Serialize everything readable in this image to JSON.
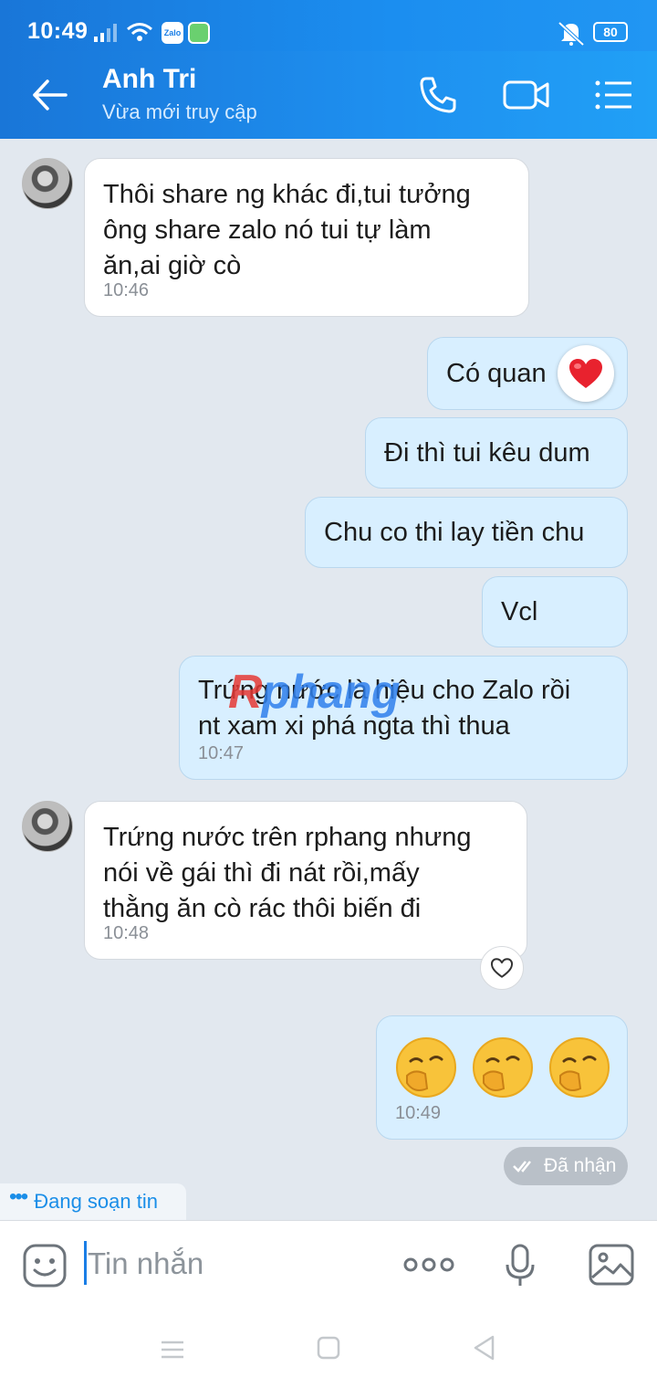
{
  "status_bar": {
    "time": "10:49",
    "battery": "80",
    "zalo_icon_label": "Zalo"
  },
  "header": {
    "contact_name": "Anh Tri",
    "presence": "Vừa mới truy cập"
  },
  "messages": [
    {
      "direction": "in",
      "text": "Thôi share ng khác đi,tui tưởng\nông share zalo nó tui tự làm\năn,ai giờ cò",
      "time": "10:46"
    },
    {
      "direction": "out",
      "text": "Có quan",
      "reaction": "heart"
    },
    {
      "direction": "out",
      "text": "Đi thì tui kêu dum"
    },
    {
      "direction": "out",
      "text": "Chu co thi lay tiền chu"
    },
    {
      "direction": "out",
      "text": "Vcl"
    },
    {
      "direction": "out",
      "text": "Trứng nước là hiệu cho Zalo rồi\nnt xam xi phá ngta thì thua",
      "time": "10:47"
    },
    {
      "direction": "in",
      "text": "Trứng nước trên rphang nhưng\nnói về gái thì đi nát rồi,mấy\nthằng ăn cò rác thôi biến đi",
      "time": "10:48"
    },
    {
      "direction": "out",
      "emojis": [
        "shy-yawn-face",
        "shy-yawn-face",
        "shy-yawn-face"
      ],
      "time": "10:49"
    }
  ],
  "watermark": {
    "part1": "R",
    "part2": "phang"
  },
  "delivery_status": "Đã nhận",
  "typing_indicator": "Đang soạn tin",
  "composer": {
    "placeholder": "Tin nhắn"
  },
  "icons": {
    "back": "arrow-left-icon",
    "call": "phone-icon",
    "video": "video-camera-icon",
    "menu": "list-menu-icon",
    "sticker": "sticker-face-icon",
    "more": "more-dots-icon",
    "mic": "microphone-icon",
    "image": "image-icon"
  },
  "colors": {
    "header": "#1e90f0",
    "outgoing_bubble": "#d8efff",
    "incoming_bubble": "#ffffff",
    "accent": "#1a7ee6",
    "background": "#e2e8ef"
  }
}
